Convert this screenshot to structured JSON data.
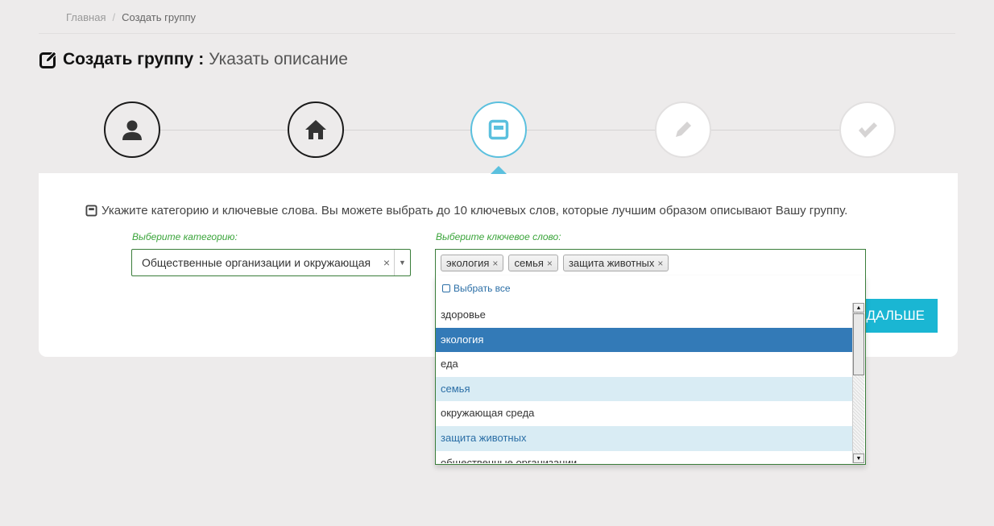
{
  "breadcrumb": {
    "home": "Главная",
    "current": "Создать группу"
  },
  "title": {
    "main": "Создать группу",
    "colon": ":",
    "sub": "Указать описание"
  },
  "steps": [
    {
      "icon": "user-icon",
      "state": "done"
    },
    {
      "icon": "home-icon",
      "state": "done"
    },
    {
      "icon": "list-icon",
      "state": "active"
    },
    {
      "icon": "pencil-icon",
      "state": "todo"
    },
    {
      "icon": "check-icon",
      "state": "todo"
    }
  ],
  "instruction": "Укажите категорию и ключевые слова. Вы можете выбрать до 10 ключевых слов, которые лучшим образом описывают Вашу группу.",
  "category": {
    "label": "Выберите категорию:",
    "value": "Общественные организации и окружающая",
    "clear": "×"
  },
  "keywords": {
    "label": "Выберите ключевое слово:",
    "tags": [
      "экология",
      "семья",
      "защита животных"
    ],
    "tag_remove": "×",
    "select_all": "Выбрать все",
    "options": [
      {
        "label": "здоровье",
        "state": "normal"
      },
      {
        "label": "экология",
        "state": "highlight"
      },
      {
        "label": "еда",
        "state": "normal"
      },
      {
        "label": "семья",
        "state": "selected"
      },
      {
        "label": "окружающая среда",
        "state": "normal"
      },
      {
        "label": "защита животных",
        "state": "selected"
      },
      {
        "label": "общественные организации",
        "state": "normal"
      }
    ]
  },
  "next_button": "ДАЛЬШЕ",
  "colors": {
    "accent": "#1ab6d3",
    "active_step": "#5bc0de",
    "highlight": "#337ab7",
    "label_green": "#3aa43a"
  }
}
